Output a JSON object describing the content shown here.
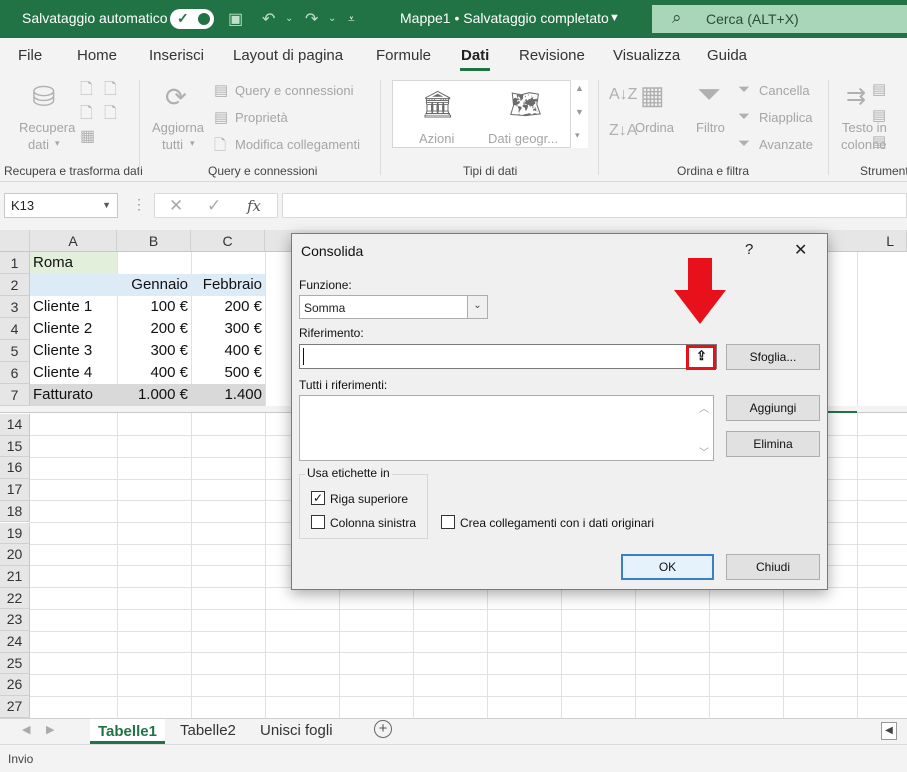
{
  "titlebar": {
    "autosave_label": "Salvataggio automatico",
    "doc_title": "Mappe1 • Salvataggio completato",
    "search_placeholder": "Cerca (ALT+X)"
  },
  "ribbon_tabs": [
    "File",
    "Home",
    "Inserisci",
    "Layout di pagina",
    "Formule",
    "Dati",
    "Revisione",
    "Visualizza",
    "Guida"
  ],
  "active_tab": "Dati",
  "ribbon": {
    "group1": {
      "button": "Recupera dati",
      "btn_l1": "Recupera",
      "btn_l2": "dati",
      "label": "Recupera e trasforma dati"
    },
    "group2": {
      "button_l1": "Aggiorna",
      "button_l2": "tutti",
      "items": [
        "Query e connessioni",
        "Proprietà",
        "Modifica collegamenti"
      ],
      "label": "Query e connessioni"
    },
    "group3": {
      "items": [
        "Azioni",
        "Dati geogr..."
      ],
      "label": "Tipi di dati"
    },
    "group4": {
      "sort": "Ordina",
      "filter": "Filtro",
      "items": [
        "Cancella",
        "Riapplica",
        "Avanzate"
      ],
      "label": "Ordina e filtra"
    },
    "group5": {
      "button_l1": "Testo in",
      "button_l2": "colonne",
      "label": "Strumenti"
    }
  },
  "formula_bar": {
    "namebox": "K13",
    "fx": "fx"
  },
  "grid": {
    "columns": [
      "A",
      "B",
      "C"
    ],
    "last_col": "L",
    "rows": [
      {
        "n": "1",
        "a": "Roma",
        "b": "",
        "c": ""
      },
      {
        "n": "2",
        "a": "",
        "b": "Gennaio",
        "c": "Febbraio"
      },
      {
        "n": "3",
        "a": "Cliente 1",
        "b": "100 €",
        "c": "200 €"
      },
      {
        "n": "4",
        "a": "Cliente 2",
        "b": "200 €",
        "c": "300 €"
      },
      {
        "n": "5",
        "a": "Cliente 3",
        "b": "300 €",
        "c": "400 €"
      },
      {
        "n": "6",
        "a": "Cliente 4",
        "b": "400 €",
        "c": "500 €"
      },
      {
        "n": "7",
        "a": "Fatturato",
        "b": "1.000 €",
        "c": "1.400"
      }
    ],
    "more_rows": [
      "14",
      "15",
      "16",
      "17",
      "18",
      "19",
      "20",
      "21",
      "22",
      "23",
      "24",
      "25",
      "26",
      "27"
    ]
  },
  "sheets": {
    "active": "Tabelle1",
    "others": [
      "Tabelle2",
      "Unisci fogli"
    ]
  },
  "status": "Invio",
  "dialog": {
    "title": "Consolida",
    "help": "?",
    "close": "✕",
    "function_label": "Funzione:",
    "function_value": "Somma",
    "reference_label": "Riferimento:",
    "browse_button": "Sfoglia...",
    "all_refs_label": "Tutti i riferimenti:",
    "add_button": "Aggiungi",
    "delete_button": "Elimina",
    "use_labels_title": "Usa etichette in",
    "top_row": "Riga superiore",
    "top_row_checked": true,
    "left_column": "Colonna sinistra",
    "left_column_checked": false,
    "create_links": "Crea collegamenti con i dati originari",
    "create_links_checked": false,
    "ok_button": "OK",
    "close_button": "Chiudi"
  },
  "colors": {
    "excel_green": "#217346",
    "annotation_red": "#e8101a"
  }
}
